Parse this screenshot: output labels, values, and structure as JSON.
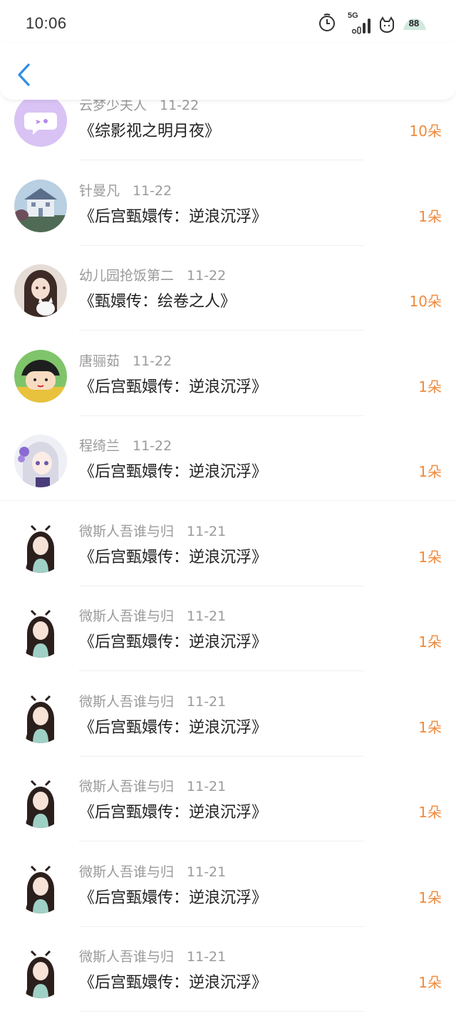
{
  "status_bar": {
    "time": "10:06",
    "network": "5G",
    "battery": "88",
    "icons": [
      "alarm-icon",
      "signal-icon",
      "cat-weather-icon",
      "battery-icon"
    ]
  },
  "header": {
    "back_icon": "chevron-left-icon",
    "accent": "#2f8fe6"
  },
  "colors": {
    "count": "#f08a3c",
    "meta": "#9a9a9a",
    "title": "#222222"
  },
  "rows": [
    {
      "avatar": "purple-chat-bubble",
      "name": "云梦少夫人",
      "date": "11-22",
      "title": "《综影视之明月夜》",
      "count": "10朵"
    },
    {
      "avatar": "castle-scene",
      "name": "针曼凡",
      "date": "11-22",
      "title": "《后宫甄嬛传：逆浪沉浮》",
      "count": "1朵"
    },
    {
      "avatar": "girl-with-cat",
      "name": "幼儿园抢饭第二",
      "date": "11-22",
      "title": "《甄嬛传：绘卷之人》",
      "count": "10朵"
    },
    {
      "avatar": "cartoon-girl",
      "name": "唐骊茹",
      "date": "11-22",
      "title": "《后宫甄嬛传：逆浪沉浮》",
      "count": "1朵"
    },
    {
      "avatar": "anime-girl-flowers",
      "name": "程绮兰",
      "date": "11-22",
      "title": "《后宫甄嬛传：逆浪沉浮》",
      "count": "1朵"
    },
    {
      "avatar": "ancient-costume-girl",
      "name": "微斯人吾谁与归",
      "date": "11-21",
      "title": "《后宫甄嬛传：逆浪沉浮》",
      "count": "1朵"
    },
    {
      "avatar": "ancient-costume-girl",
      "name": "微斯人吾谁与归",
      "date": "11-21",
      "title": "《后宫甄嬛传：逆浪沉浮》",
      "count": "1朵"
    },
    {
      "avatar": "ancient-costume-girl",
      "name": "微斯人吾谁与归",
      "date": "11-21",
      "title": "《后宫甄嬛传：逆浪沉浮》",
      "count": "1朵"
    },
    {
      "avatar": "ancient-costume-girl",
      "name": "微斯人吾谁与归",
      "date": "11-21",
      "title": "《后宫甄嬛传：逆浪沉浮》",
      "count": "1朵"
    },
    {
      "avatar": "ancient-costume-girl",
      "name": "微斯人吾谁与归",
      "date": "11-21",
      "title": "《后宫甄嬛传：逆浪沉浮》",
      "count": "1朵"
    },
    {
      "avatar": "ancient-costume-girl",
      "name": "微斯人吾谁与归",
      "date": "11-21",
      "title": "《后宫甄嬛传：逆浪沉浮》",
      "count": "1朵"
    }
  ]
}
